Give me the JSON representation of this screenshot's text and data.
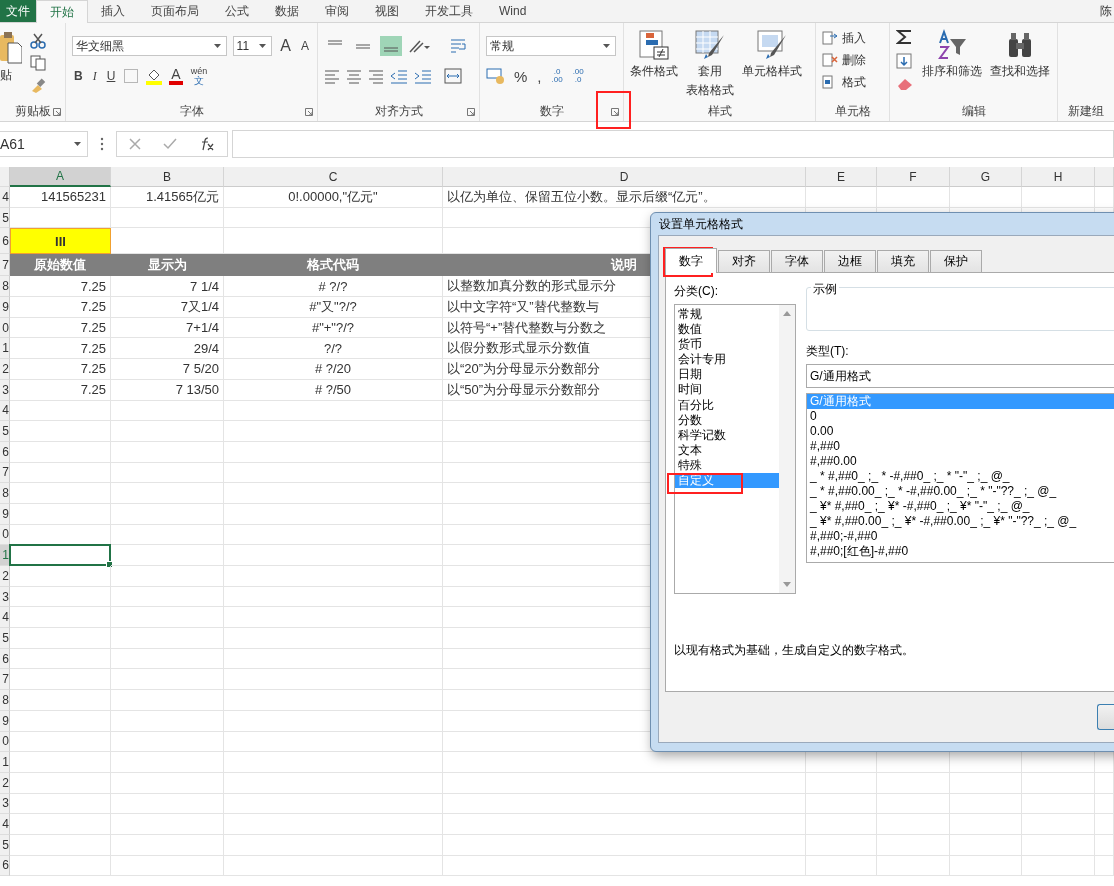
{
  "ribbon_tabs": [
    {
      "label": "文件",
      "kind": "file",
      "selected": false
    },
    {
      "label": "开始",
      "kind": "tab",
      "selected": true
    },
    {
      "label": "插入",
      "kind": "tab",
      "selected": false
    },
    {
      "label": "页面布局",
      "kind": "tab",
      "selected": false
    },
    {
      "label": "公式",
      "kind": "tab",
      "selected": false
    },
    {
      "label": "数据",
      "kind": "tab",
      "selected": false
    },
    {
      "label": "审阅",
      "kind": "tab",
      "selected": false
    },
    {
      "label": "视图",
      "kind": "tab",
      "selected": false
    },
    {
      "label": "开发工具",
      "kind": "tab",
      "selected": false
    },
    {
      "label": "Wind",
      "kind": "tab",
      "selected": false
    }
  ],
  "user_name": "陈",
  "clipboard": {
    "paste_label": "贴",
    "group_label": "剪贴板"
  },
  "font": {
    "font_name": "华文细黑",
    "font_size": "11",
    "grow_font": "A",
    "shrink_font": "A",
    "bold": "B",
    "italic": "I",
    "underline": "U",
    "font_color": "A",
    "phonetic_top": "wén",
    "phonetic_bottom": "文",
    "group_label": "字体"
  },
  "alignment": {
    "align_buttons": [
      {
        "kind": "top",
        "selected": false
      },
      {
        "kind": "middle",
        "selected": false
      },
      {
        "kind": "bottom",
        "selected": true
      }
    ],
    "group_label": "对齐方式"
  },
  "number": {
    "format": "常规",
    "percent": "%",
    "comma": ",",
    "increase_decimal": [
      ".0",
      ".00"
    ],
    "decrease_decimal": [
      ".00",
      ".0"
    ],
    "group_label": "数字",
    "launcher_highlighted": true
  },
  "styles": {
    "buttons": [
      {
        "kind": "conditional",
        "label": "条件格式"
      },
      {
        "kind": "table",
        "label": "套用",
        "label_2": "表格格式"
      },
      {
        "kind": "cell_style",
        "label": "单元格样式"
      }
    ],
    "group_label": "样式"
  },
  "cells": {
    "buttons": [
      {
        "kind": "insert",
        "label": "插入"
      },
      {
        "kind": "delete",
        "label": "删除"
      },
      {
        "kind": "format",
        "label": "格式"
      }
    ],
    "group_label": "单元格"
  },
  "editing": {
    "buttons": [
      {
        "kind": "sort",
        "label": "排序和筛选"
      },
      {
        "kind": "find",
        "label": "查找和选择"
      }
    ],
    "group_label": "编辑"
  },
  "new_group": {
    "group_label": "新建组"
  },
  "formula_bar": {
    "name_box": "A61"
  },
  "sheet": {
    "columns": [
      {
        "label": "A",
        "selected": true
      },
      {
        "label": "B",
        "selected": false
      },
      {
        "label": "C",
        "selected": false
      },
      {
        "label": "D",
        "selected": false
      },
      {
        "label": "E",
        "selected": false
      },
      {
        "label": "F",
        "selected": false
      },
      {
        "label": "G",
        "selected": false
      },
      {
        "label": "H",
        "selected": false
      }
    ],
    "rows": [
      {
        "header": "4",
        "kind": "data",
        "selected": false,
        "cells": [
          "141565231",
          "1.41565亿元",
          "0!.00000,\"亿元\"",
          "以亿为单位、保留五位小数。显示后缀“亿元”。"
        ]
      },
      {
        "header": "5",
        "kind": "empty",
        "selected": false
      },
      {
        "header": "6",
        "kind": "highlight",
        "selected": false,
        "cells": [
          "III"
        ]
      },
      {
        "header": "7",
        "kind": "header",
        "selected": false,
        "cells": [
          "原始数值",
          "显示为",
          "格式代码",
          "说明"
        ]
      },
      {
        "header": "8",
        "kind": "data",
        "selected": false,
        "cells": [
          "7.25",
          "7 1/4",
          "# ?/?",
          "以整数加真分数的形式显示分"
        ]
      },
      {
        "header": "9",
        "kind": "data",
        "selected": false,
        "cells": [
          "7.25",
          "7又1/4",
          "#\"又\"?/?",
          "以中文字符“又”替代整数与"
        ]
      },
      {
        "header": "0",
        "kind": "data",
        "selected": false,
        "cells": [
          "7.25",
          "7+1/4",
          "#\"+\"?/?",
          "以符号“+”替代整数与分数之"
        ]
      },
      {
        "header": "1",
        "kind": "data",
        "selected": false,
        "cells": [
          "7.25",
          "29/4",
          "?/?",
          "以假分数形式显示分数值"
        ]
      },
      {
        "header": "2",
        "kind": "data",
        "selected": false,
        "cells": [
          "7.25",
          "7 5/20",
          "# ?/20",
          "以“20”为分母显示分数部分"
        ]
      },
      {
        "header": "3",
        "kind": "data",
        "selected": false,
        "cells": [
          "7.25",
          "7 13/50",
          "# ?/50",
          "以“50”为分母显示分数部分"
        ]
      },
      {
        "header": "4",
        "kind": "empty",
        "selected": false
      },
      {
        "header": "5",
        "kind": "empty",
        "selected": false
      },
      {
        "header": "6",
        "kind": "empty",
        "selected": false
      },
      {
        "header": "7",
        "kind": "empty",
        "selected": false
      },
      {
        "header": "8",
        "kind": "empty",
        "selected": false
      },
      {
        "header": "9",
        "kind": "empty",
        "selected": false
      },
      {
        "header": "0",
        "kind": "empty",
        "selected": false
      },
      {
        "header": "1",
        "kind": "empty",
        "selected": true
      },
      {
        "header": "2",
        "kind": "empty",
        "selected": false
      },
      {
        "header": "3",
        "kind": "empty",
        "selected": false
      },
      {
        "header": "4",
        "kind": "empty",
        "selected": false
      },
      {
        "header": "5",
        "kind": "empty",
        "selected": false
      },
      {
        "header": "6",
        "kind": "empty",
        "selected": false
      },
      {
        "header": "7",
        "kind": "empty",
        "selected": false
      },
      {
        "header": "8",
        "kind": "empty",
        "selected": false
      },
      {
        "header": "9",
        "kind": "empty",
        "selected": false
      },
      {
        "header": "0",
        "kind": "empty",
        "selected": false
      },
      {
        "header": "1",
        "kind": "empty",
        "selected": false
      },
      {
        "header": "2",
        "kind": "empty",
        "selected": false
      },
      {
        "header": "3",
        "kind": "empty",
        "selected": false
      },
      {
        "header": "4",
        "kind": "empty",
        "selected": false
      },
      {
        "header": "5",
        "kind": "empty",
        "selected": false
      },
      {
        "header": "6",
        "kind": "empty",
        "selected": false
      }
    ]
  },
  "dialog": {
    "title": "设置单元格格式",
    "tabs": [
      {
        "label": "数字",
        "selected": true,
        "highlighted": true
      },
      {
        "label": "对齐",
        "selected": false,
        "highlighted": false
      },
      {
        "label": "字体",
        "selected": false,
        "highlighted": false
      },
      {
        "label": "边框",
        "selected": false,
        "highlighted": false
      },
      {
        "label": "填充",
        "selected": false,
        "highlighted": false
      },
      {
        "label": "保护",
        "selected": false,
        "highlighted": false
      }
    ],
    "category_label": "分类(C):",
    "categories": [
      {
        "label": "常规",
        "selected": false,
        "highlighted": false
      },
      {
        "label": "数值",
        "selected": false,
        "highlighted": false
      },
      {
        "label": "货币",
        "selected": false,
        "highlighted": false
      },
      {
        "label": "会计专用",
        "selected": false,
        "highlighted": false
      },
      {
        "label": "日期",
        "selected": false,
        "highlighted": false
      },
      {
        "label": "时间",
        "selected": false,
        "highlighted": false
      },
      {
        "label": "百分比",
        "selected": false,
        "highlighted": false
      },
      {
        "label": "分数",
        "selected": false,
        "highlighted": false
      },
      {
        "label": "科学记数",
        "selected": false,
        "highlighted": false
      },
      {
        "label": "文本",
        "selected": false,
        "highlighted": false
      },
      {
        "label": "特殊",
        "selected": false,
        "highlighted": false
      },
      {
        "label": "自定义",
        "selected": true,
        "highlighted": true
      }
    ],
    "sample_label": "示例",
    "type_label": "类型(T):",
    "type_value": "G/通用格式",
    "types": [
      {
        "label": "G/通用格式",
        "selected": true
      },
      {
        "label": "0",
        "selected": false
      },
      {
        "label": "0.00",
        "selected": false
      },
      {
        "label": "#,##0",
        "selected": false
      },
      {
        "label": "#,##0.00",
        "selected": false
      },
      {
        "label": "_ * #,##0_ ;_ * -#,##0_ ;_ * \"-\"_ ;_ @_",
        "selected": false
      },
      {
        "label": "_ * #,##0.00_ ;_ * -#,##0.00_ ;_ * \"-\"??_ ;_ @_",
        "selected": false
      },
      {
        "label": "_ ¥* #,##0_ ;_ ¥* -#,##0_ ;_ ¥* \"-\"_ ;_ @_",
        "selected": false
      },
      {
        "label": "_ ¥* #,##0.00_ ;_ ¥* -#,##0.00_ ;_ ¥* \"-\"??_ ;_ @_",
        "selected": false
      },
      {
        "label": "#,##0;-#,##0",
        "selected": false
      },
      {
        "label": "#,##0;[红色]-#,##0",
        "selected": false
      }
    ],
    "description": "以现有格式为基础，生成自定义的数字格式。"
  }
}
